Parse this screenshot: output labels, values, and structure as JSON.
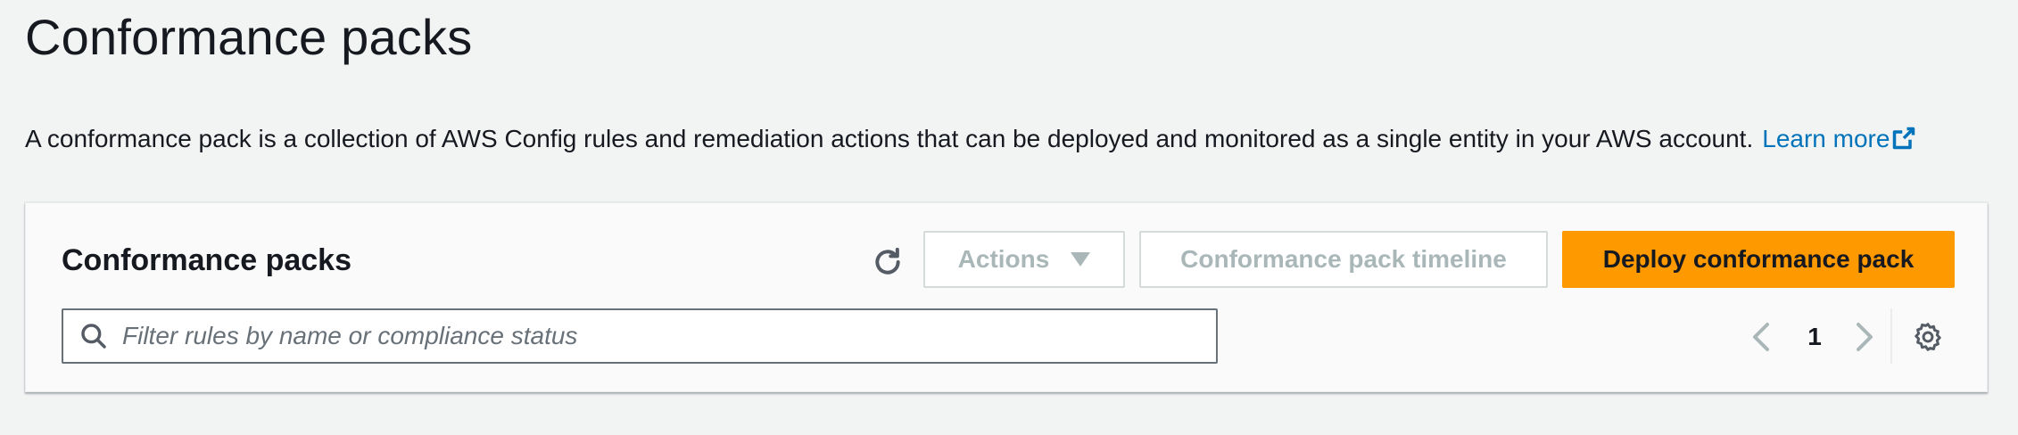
{
  "page": {
    "title": "Conformance packs",
    "description": "A conformance pack is a collection of AWS Config rules and remediation actions that can be deployed and monitored as a single entity in your AWS account.",
    "learn_more_label": "Learn more"
  },
  "panel": {
    "title": "Conformance packs",
    "refresh_icon": "refresh-icon",
    "actions_label": "Actions",
    "timeline_label": "Conformance pack timeline",
    "deploy_label": "Deploy conformance pack",
    "search": {
      "placeholder": "Filter rules by name or compliance status",
      "value": ""
    },
    "pagination": {
      "current_page": "1"
    }
  },
  "colors": {
    "background": "#f2f3f3",
    "panel_background": "#fafafa",
    "primary_button": "#ff9900",
    "link": "#0073bb",
    "disabled_text": "#aab7b8",
    "text": "#16191f"
  }
}
